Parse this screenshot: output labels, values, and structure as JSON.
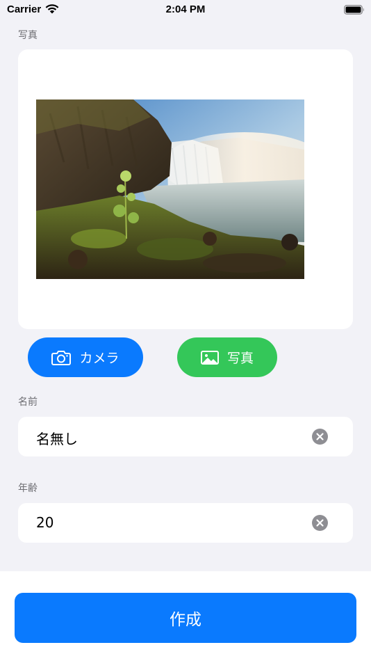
{
  "status_bar": {
    "carrier": "Carrier",
    "time": "2:04 PM",
    "icons": [
      "wifi-icon",
      "battery-icon"
    ]
  },
  "photo_section": {
    "label": "写真",
    "image_description": "waterfall-landscape-photo"
  },
  "buttons": {
    "camera": {
      "label": "カメラ",
      "icon": "camera-icon",
      "color": "#0a7afe"
    },
    "library": {
      "label": "写真",
      "icon": "image-icon",
      "color": "#34c759"
    }
  },
  "name_section": {
    "label": "名前",
    "value": "名無し",
    "clear_icon": "clear-icon"
  },
  "age_section": {
    "label": "年齢",
    "value": "20",
    "clear_icon": "clear-icon"
  },
  "footer": {
    "create_label": "作成",
    "color": "#0a7afe"
  },
  "colors": {
    "background": "#f2f2f7",
    "card": "#ffffff",
    "label": "#6d6d72",
    "clear": "#8e8e93"
  }
}
